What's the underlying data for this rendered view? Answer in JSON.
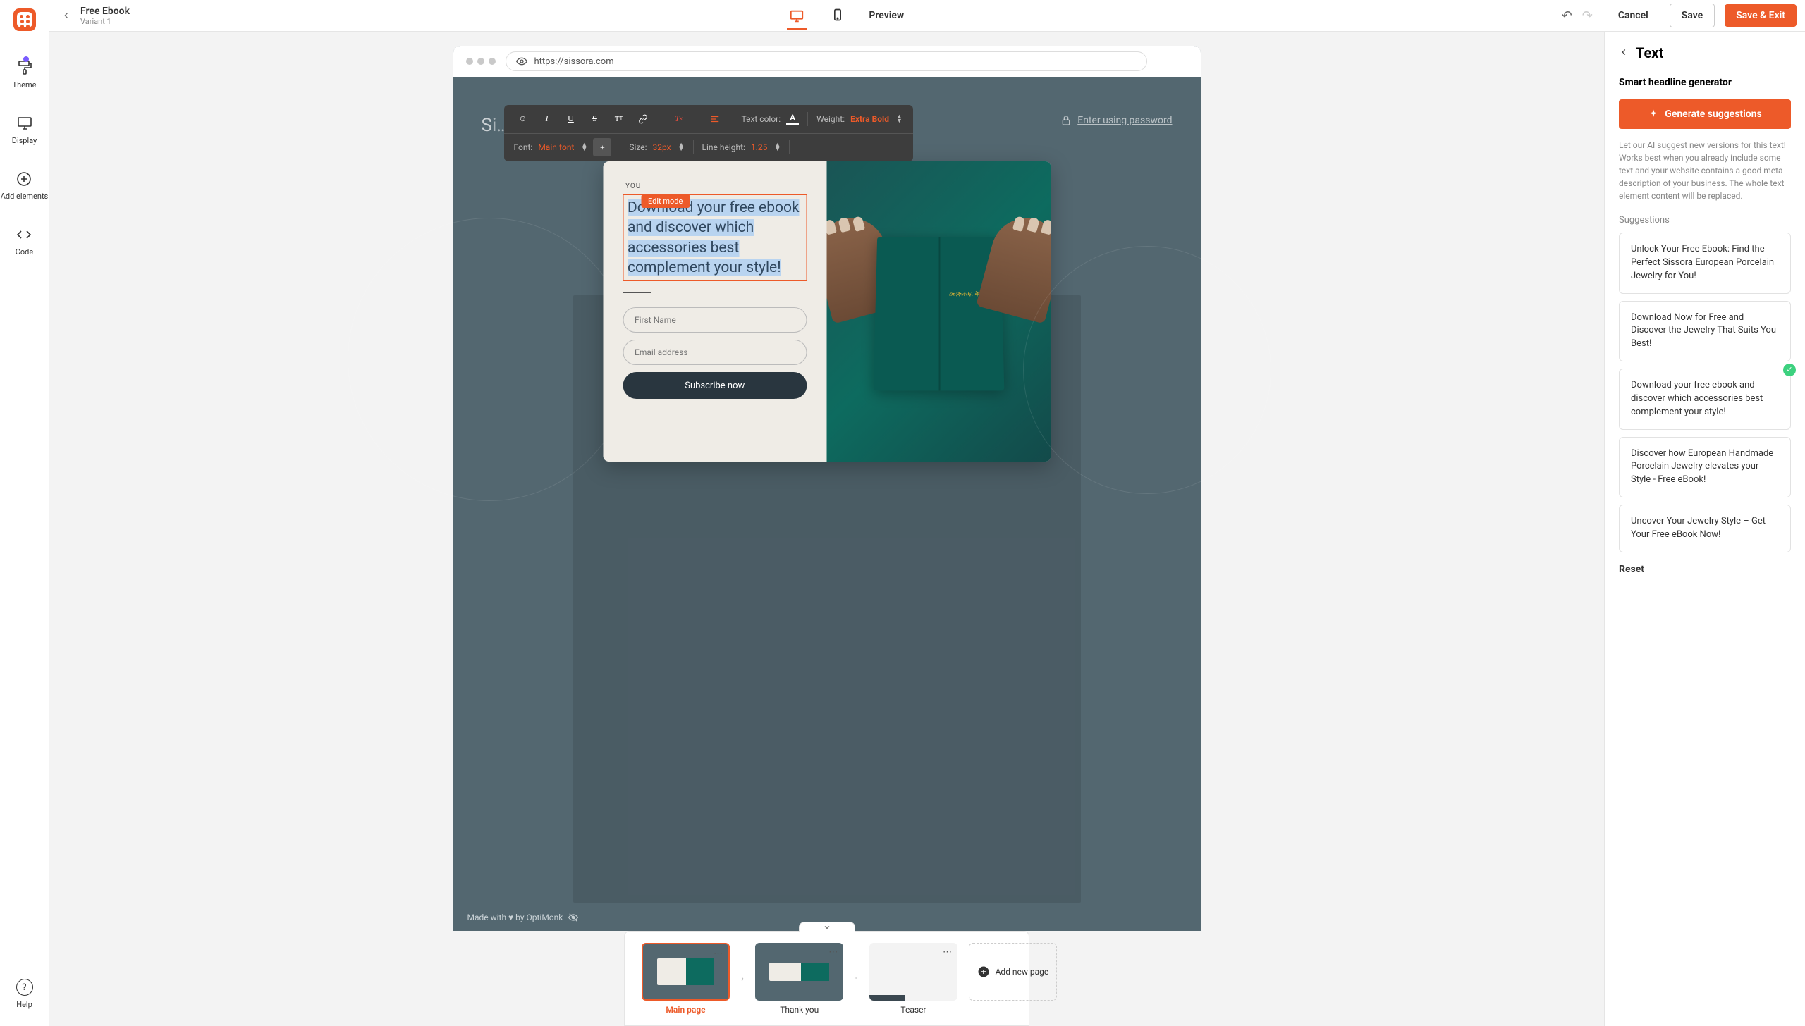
{
  "rail": {
    "theme": "Theme",
    "display": "Display",
    "add": "Add elements",
    "code": "Code",
    "help": "Help"
  },
  "header": {
    "title": "Free Ebook",
    "subtitle": "Variant 1",
    "preview": "Preview",
    "cancel": "Cancel",
    "save": "Save",
    "save_exit": "Save & Exit"
  },
  "browser": {
    "url": "https://sissora.com",
    "brand": "Sissora",
    "enter_pw": "Enter using password",
    "made_with": "Made with ♥ by OptiMonk"
  },
  "toolbar": {
    "text_color": "Text color:",
    "weight_label": "Weight:",
    "weight_value": "Extra Bold",
    "font_label": "Font:",
    "font_value": "Main font",
    "size_label": "Size:",
    "size_value": "32px",
    "lh_label": "Line height:",
    "lh_value": "1.25"
  },
  "popup": {
    "edit_mode": "Edit mode",
    "kicker": "YOU",
    "headline": "Download your free ebook and discover which accessories best complement your style!",
    "first_name": "First Name",
    "email": "Email address",
    "subscribe": "Subscribe now",
    "book_text": "መጽሐፍ\nቅዱስ"
  },
  "pages": {
    "main": "Main page",
    "thank": "Thank you",
    "teaser": "Teaser",
    "add": "Add new page"
  },
  "panel": {
    "title": "Text",
    "subtitle": "Smart headline generator",
    "generate": "Generate suggestions",
    "desc": "Let our AI suggest new versions for this text! Works best when you already include some text and your website contains a good meta-description of your business. The whole text element content will be replaced.",
    "sug_label": "Suggestions",
    "suggestions": [
      "Unlock Your Free Ebook: Find the Perfect Sissora European Porcelain Jewelry for You!",
      "Download Now for Free and Discover the Jewelry That Suits You Best!",
      "Download your free ebook and discover which accessories best complement your style!",
      "Discover how European Handmade Porcelain Jewelry elevates your Style - Free eBook!",
      "Uncover Your Jewelry Style – Get Your Free eBook Now!"
    ],
    "reset": "Reset"
  }
}
